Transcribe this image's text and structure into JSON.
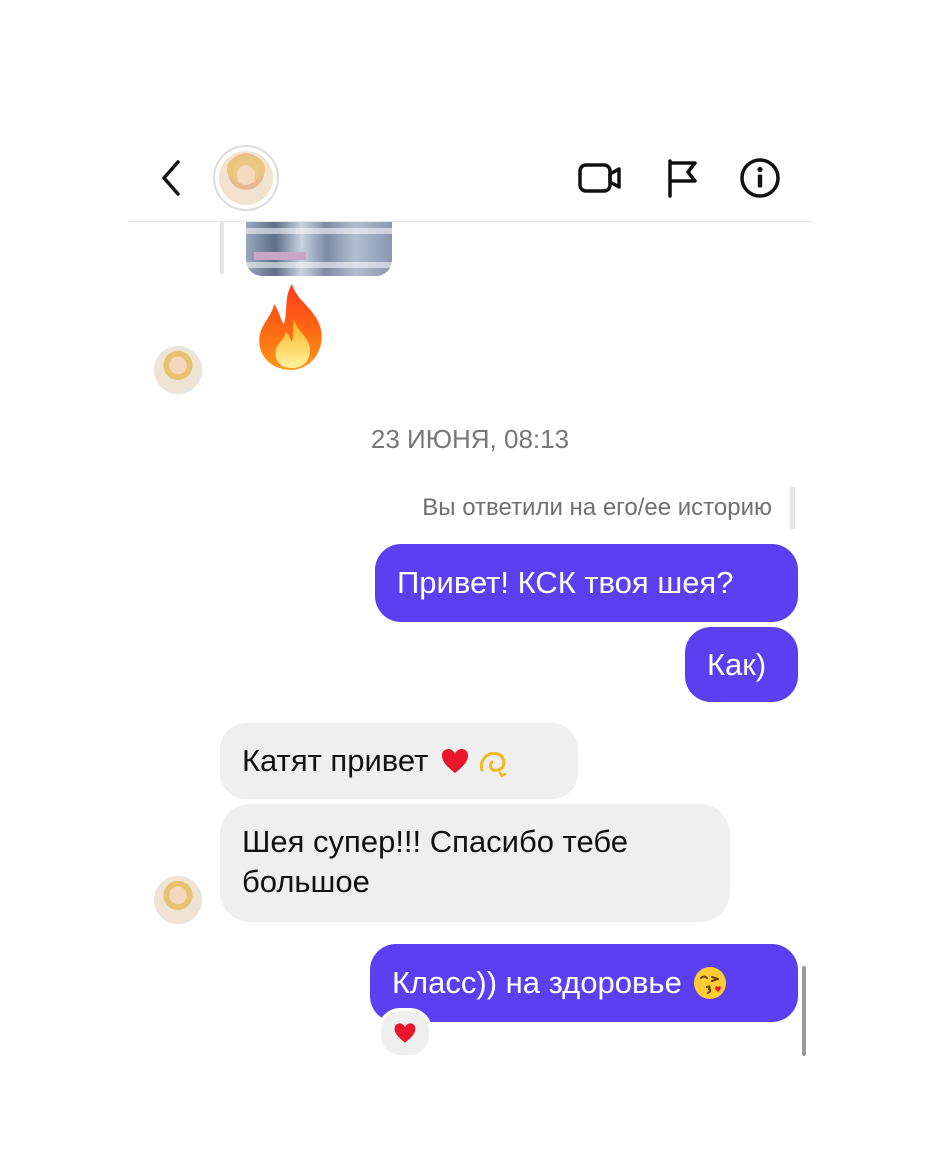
{
  "header": {
    "back_icon": "chevron-left-icon",
    "actions": [
      "video-call-icon",
      "flag-icon",
      "info-icon"
    ]
  },
  "messages": {
    "fire_emoji": "🔥",
    "timestamp": "23 ИЮНЯ, 08:13",
    "story_reply_note": "Вы ответили на его/ее историю",
    "sent_1": "Привет! КСК твоя шея?",
    "sent_2": "Как)",
    "recv_1": "Катят  привет",
    "recv_2_line1": "Шея супер!!! Спасибо  тебе",
    "recv_2_line2": "большое",
    "sent_3": "Класс)) на здоровье",
    "reaction": "heart-emoji"
  },
  "colors": {
    "sent_bubble": "#5b3ff0",
    "received_bubble": "#efefef",
    "timestamp_text": "#777777"
  }
}
